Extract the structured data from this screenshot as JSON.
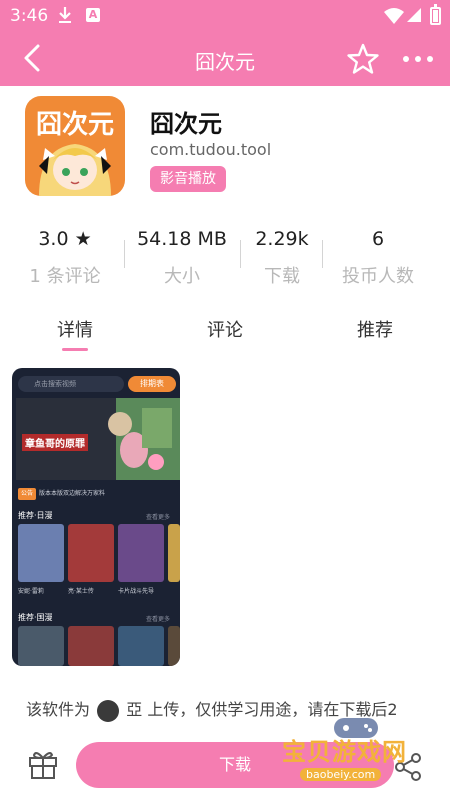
{
  "status_bar": {
    "time": "3:46",
    "a_icon_letter": "A"
  },
  "header": {
    "title": "囧次元"
  },
  "app": {
    "icon_text": "囧次元",
    "name": "囧次元",
    "package": "com.tudou.tool",
    "category": "影音播放"
  },
  "stats": [
    {
      "value": "3.0 ★",
      "label": "1 条评论"
    },
    {
      "value": "54.18 MB",
      "label": "大小"
    },
    {
      "value": "2.29k",
      "label": "下载"
    },
    {
      "value": "6",
      "label": "投币人数"
    }
  ],
  "tabs": [
    {
      "label": "详情",
      "active": true
    },
    {
      "label": "评论",
      "active": false
    },
    {
      "label": "推荐",
      "active": false
    }
  ],
  "preview": {
    "search_placeholder": "点击搜索视频",
    "rank_button": "排期表",
    "banner_text": "章鱼哥的原罪",
    "notice_badge": "公告",
    "notice_text": "版本本版双边解决万家料",
    "section1_title": "推荐·日漫",
    "section1_more": "查看更多",
    "section1_captions": [
      "安妮·雷莉",
      "亮·某士传",
      "卡片战斗先导"
    ],
    "section2_title": "推荐·国漫",
    "section2_more": "查看更多"
  },
  "uploader_line": {
    "prefix": "该软件为",
    "name": "亞",
    "suffix": "上传，仅供学习用途，请在下载后2"
  },
  "bottom": {
    "download_label": "下载"
  },
  "watermark": {
    "title": "宝贝游戏网",
    "url": "baobeiy.com"
  },
  "colors": {
    "accent": "#f57db1",
    "icon_bg": "#f08a36"
  }
}
